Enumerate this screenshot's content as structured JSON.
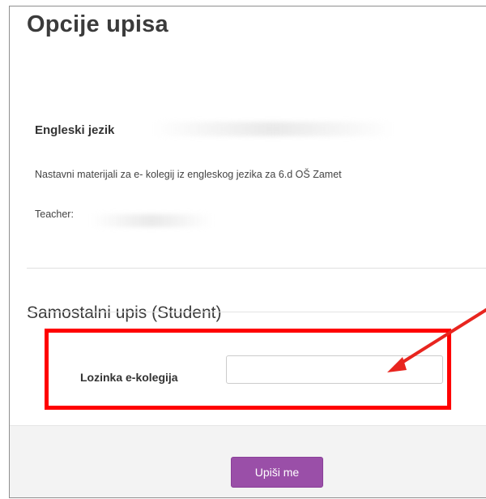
{
  "page": {
    "title": "Opcije upisa"
  },
  "course": {
    "name": "Engleski jezik",
    "summary": "Nastavni materijali za e- kolegij iz engleskog jezika za 6.d OŠ Zamet",
    "teacher_label": "Teacher:"
  },
  "enrolment": {
    "heading": "Samostalni upis (Student)",
    "password_label": "Lozinka e-kolegija",
    "password_value": "",
    "submit_label": "Upiši me"
  },
  "colors": {
    "accent": "#9a4fa8",
    "annotation": "#ff0000"
  }
}
